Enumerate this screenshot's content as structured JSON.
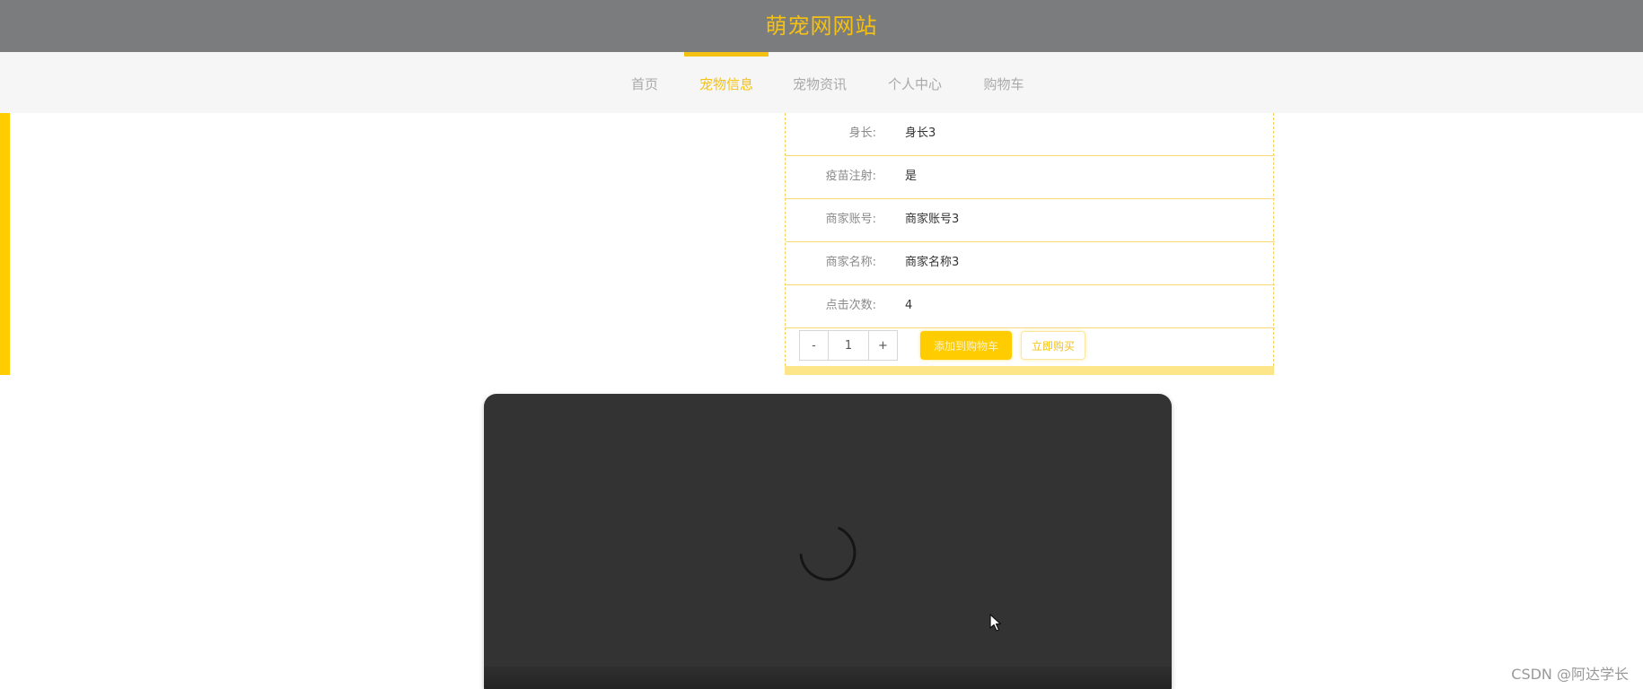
{
  "header": {
    "title": "萌宠网网站"
  },
  "nav": {
    "items": [
      {
        "label": "首页"
      },
      {
        "label": "宠物信息"
      },
      {
        "label": "宠物资讯"
      },
      {
        "label": "个人中心"
      },
      {
        "label": "购物车"
      }
    ],
    "active": "宠物信息"
  },
  "details": {
    "rows": [
      {
        "label": "身长:",
        "value": "身长3"
      },
      {
        "label": "疫苗注射:",
        "value": "是"
      },
      {
        "label": "商家账号:",
        "value": "商家账号3"
      },
      {
        "label": "商家名称:",
        "value": "商家名称3"
      },
      {
        "label": "点击次数:",
        "value": "4"
      }
    ]
  },
  "purchase": {
    "minus": "-",
    "quantity": "1",
    "plus": "+",
    "add_to_cart": "添加到购物车",
    "buy_now": "立即购买"
  },
  "watermark": "CSDN @阿达学长",
  "colors": {
    "accent": "#f5c113",
    "header_bg": "#7a7c7d",
    "loader_bg": "#333333"
  },
  "icons": {
    "loading": "loading-spinner-icon",
    "cursor": "mouse-pointer-icon"
  }
}
